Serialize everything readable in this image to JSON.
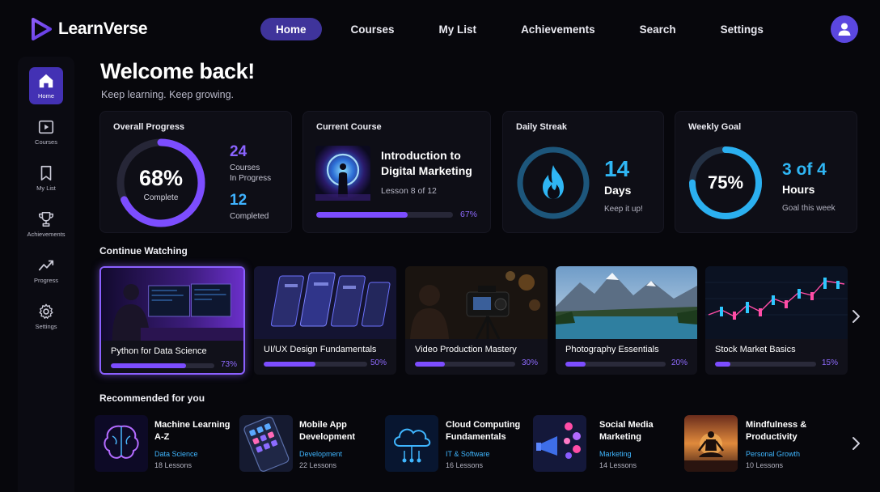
{
  "app": {
    "name": "LearnVerse"
  },
  "nav": {
    "home": "Home",
    "courses": "Courses",
    "my_list": "My List",
    "achievements": "Achievements",
    "search": "Search",
    "settings": "Settings"
  },
  "sidebar": {
    "items": [
      {
        "label": "Home",
        "icon": "home-icon"
      },
      {
        "label": "Courses",
        "icon": "play-icon"
      },
      {
        "label": "My List",
        "icon": "bookmark-icon"
      },
      {
        "label": "Achievements",
        "icon": "trophy-icon"
      },
      {
        "label": "Progress",
        "icon": "trend-icon"
      },
      {
        "label": "Settings",
        "icon": "gear-icon"
      }
    ]
  },
  "welcome": {
    "title": "Welcome back!",
    "subtitle": "Keep learning. Keep growing."
  },
  "overall": {
    "title": "Overall Progress",
    "percent_label": "68%",
    "complete_label": "Complete",
    "fraction": 0.68,
    "in_progress_num": "24",
    "in_progress_label_1": "Courses",
    "in_progress_label_2": "In Progress",
    "completed_num": "12",
    "completed_label": "Completed"
  },
  "current_course": {
    "title": "Current Course",
    "course_line_1": "Introduction to",
    "course_line_2": "Digital Marketing",
    "lesson": "Lesson 8 of 12",
    "percent_label": "67%",
    "fraction": 0.67
  },
  "streak": {
    "title": "Daily Streak",
    "num": "14",
    "unit": "Days",
    "note": "Keep it up!"
  },
  "weekly_goal": {
    "title": "Weekly Goal",
    "percent_label": "75%",
    "fraction": 0.75,
    "value": "3 of 4",
    "unit": "Hours",
    "note": "Goal this week"
  },
  "continue_watching": {
    "title": "Continue Watching",
    "items": [
      {
        "title": "Python for Data Science",
        "percent_label": "73%",
        "fraction": 0.73
      },
      {
        "title": "UI/UX Design Fundamentals",
        "percent_label": "50%",
        "fraction": 0.5
      },
      {
        "title": "Video Production Mastery",
        "percent_label": "30%",
        "fraction": 0.3
      },
      {
        "title": "Photography Essentials",
        "percent_label": "20%",
        "fraction": 0.2
      },
      {
        "title": "Stock Market Basics",
        "percent_label": "15%",
        "fraction": 0.15
      }
    ]
  },
  "recommended": {
    "title": "Recommended for you",
    "items": [
      {
        "title_1": "Machine Learning",
        "title_2": "A-Z",
        "category": "Data Science",
        "lessons": "18 Lessons"
      },
      {
        "title_1": "Mobile App",
        "title_2": "Development",
        "category": "Development",
        "lessons": "22 Lessons"
      },
      {
        "title_1": "Cloud Computing",
        "title_2": "Fundamentals",
        "category": "IT & Software",
        "lessons": "16 Lessons"
      },
      {
        "title_1": "Social Media",
        "title_2": "Marketing",
        "category": "Marketing",
        "lessons": "14 Lessons"
      },
      {
        "title_1": "Mindfulness &",
        "title_2": "Productivity",
        "category": "Personal Growth",
        "lessons": "10 Lessons"
      }
    ]
  },
  "colors": {
    "accent_purple": "#7c4dff",
    "accent_blue": "#2bb0f0",
    "active_nav": "#3f349b",
    "background": "#07070c"
  }
}
